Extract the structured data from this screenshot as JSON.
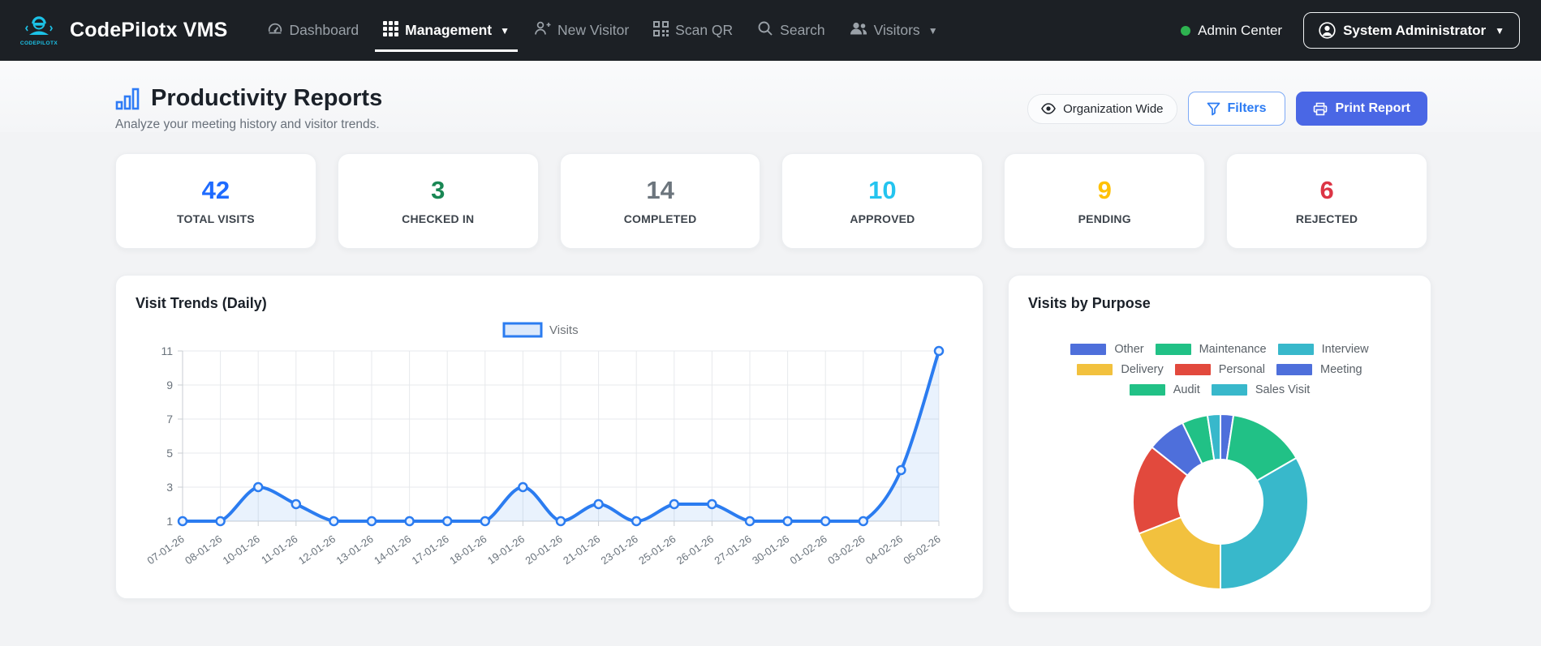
{
  "navbar": {
    "logo_text": "CODEPILOTX",
    "brand": "CodePilotx VMS",
    "items": [
      {
        "label": "Dashboard"
      },
      {
        "label": "Management"
      },
      {
        "label": "New Visitor"
      },
      {
        "label": "Scan QR"
      },
      {
        "label": "Search"
      },
      {
        "label": "Visitors"
      }
    ],
    "status": {
      "label": "Admin Center",
      "dot_color": "#2eb350"
    },
    "user_menu": {
      "label": "System Administrator"
    }
  },
  "header": {
    "title": "Productivity Reports",
    "subtitle": "Analyze your meeting history and visitor trends.",
    "scope_label": "Organization Wide",
    "filters_label": "Filters",
    "print_label": "Print Report"
  },
  "stats": [
    {
      "value": "42",
      "label": "TOTAL VISITS",
      "color": "#1f6bff"
    },
    {
      "value": "3",
      "label": "CHECKED IN",
      "color": "#198754"
    },
    {
      "value": "14",
      "label": "COMPLETED",
      "color": "#6c757d"
    },
    {
      "value": "10",
      "label": "APPROVED",
      "color": "#24c4ef"
    },
    {
      "value": "9",
      "label": "PENDING",
      "color": "#ffc107"
    },
    {
      "value": "6",
      "label": "REJECTED",
      "color": "#dc3545"
    }
  ],
  "chart_data": [
    {
      "type": "line",
      "title": "Visit Trends (Daily)",
      "x": [
        "07-01-26",
        "08-01-26",
        "10-01-26",
        "11-01-26",
        "12-01-26",
        "13-01-26",
        "14-01-26",
        "17-01-26",
        "18-01-26",
        "19-01-26",
        "20-01-26",
        "21-01-26",
        "23-01-26",
        "25-01-26",
        "26-01-26",
        "27-01-26",
        "30-01-26",
        "01-02-26",
        "03-02-26",
        "04-02-26",
        "05-02-26"
      ],
      "series": [
        {
          "name": "Visits",
          "color": "#2b7cf0",
          "fill_color": "#2b7cf0",
          "fill_opacity": 0.1,
          "values": [
            1,
            1,
            3,
            2,
            1,
            1,
            1,
            1,
            1,
            3,
            1,
            2,
            1,
            2,
            2,
            1,
            1,
            1,
            1,
            4,
            11
          ]
        }
      ],
      "yticks": [
        1,
        3,
        5,
        7,
        9,
        11
      ],
      "ylim": [
        1,
        11
      ],
      "grid": true,
      "legend_position": "top"
    },
    {
      "type": "pie",
      "title": "Visits by Purpose",
      "donut": true,
      "segments": [
        {
          "label": "Other",
          "value": 1,
          "color": "#4e6fdb"
        },
        {
          "label": "Maintenance",
          "value": 6,
          "color": "#21c186"
        },
        {
          "label": "Interview",
          "value": 14,
          "color": "#38b8cb"
        },
        {
          "label": "Delivery",
          "value": 8,
          "color": "#f2c13e"
        },
        {
          "label": "Personal",
          "value": 7,
          "color": "#e2493d"
        },
        {
          "label": "Meeting",
          "value": 3,
          "color": "#4e6fdb"
        },
        {
          "label": "Audit",
          "value": 2,
          "color": "#21c186"
        },
        {
          "label": "Sales Visit",
          "value": 1,
          "color": "#38b8cb"
        }
      ],
      "legend_rows": [
        [
          "Other",
          "Maintenance",
          "Interview"
        ],
        [
          "Delivery",
          "Personal",
          "Meeting"
        ],
        [
          "Audit",
          "Sales Visit"
        ]
      ],
      "legend_position": "top"
    }
  ]
}
